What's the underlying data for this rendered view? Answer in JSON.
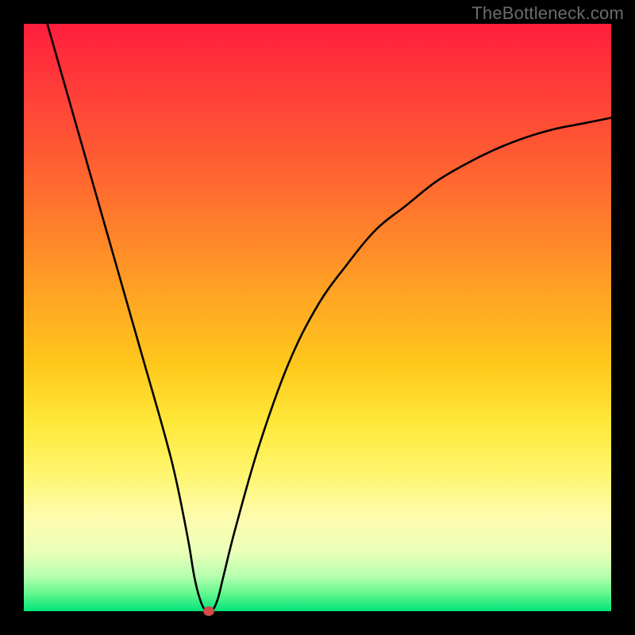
{
  "watermark": "TheBottleneck.com",
  "colors": {
    "background": "#000000",
    "curve": "#000000",
    "dot": "#d94a4a"
  },
  "chart_data": {
    "type": "line",
    "title": "",
    "xlabel": "",
    "ylabel": "",
    "xlim": [
      0,
      100
    ],
    "ylim": [
      0,
      100
    ],
    "grid": false,
    "legend": false,
    "background_gradient": {
      "top": "#ff1e3c",
      "middle": "#ffe83a",
      "bottom": "#00e47a"
    },
    "series": [
      {
        "name": "bottleneck-curve",
        "x": [
          4,
          8,
          12,
          16,
          20,
          24,
          26,
          28,
          29,
          30,
          31,
          32,
          33,
          34,
          36,
          40,
          45,
          50,
          55,
          60,
          65,
          70,
          75,
          80,
          85,
          90,
          95,
          100
        ],
        "y": [
          100,
          86,
          72,
          58,
          44,
          30,
          22,
          12,
          6,
          2,
          0,
          0,
          2,
          6,
          14,
          28,
          42,
          52,
          59,
          65,
          69,
          73,
          76,
          78.5,
          80.5,
          82,
          83,
          84
        ]
      }
    ],
    "marker": {
      "x": 31.5,
      "y": 0,
      "shape": "ellipse",
      "color": "#d94a4a"
    }
  }
}
